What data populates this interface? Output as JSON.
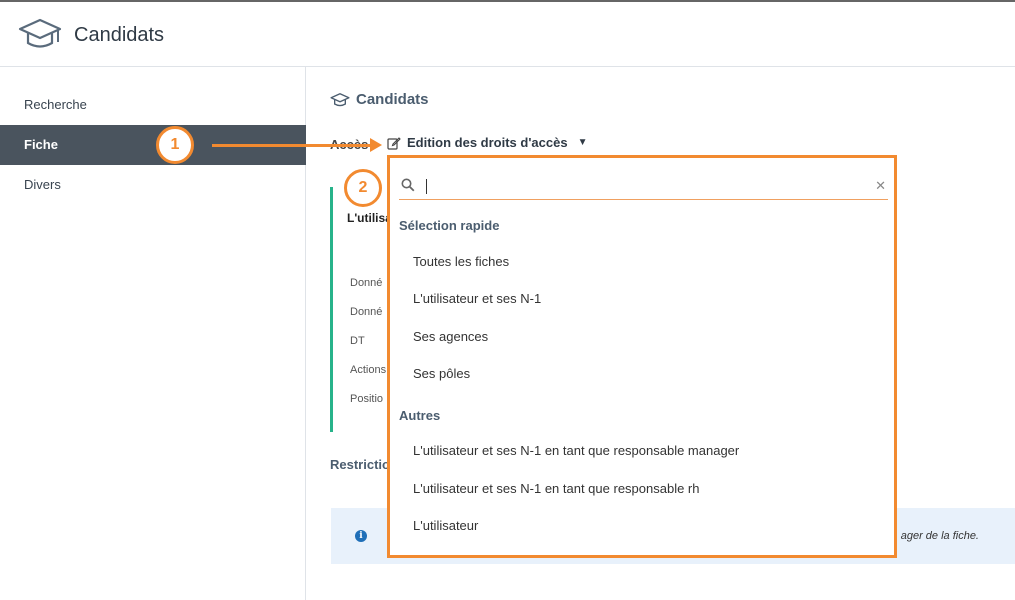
{
  "header": {
    "title": "Candidats",
    "logo_icon": "graduation-cap-icon"
  },
  "sidebar": {
    "items": [
      {
        "label": "Recherche",
        "active": false
      },
      {
        "label": "Fiche",
        "active": true
      },
      {
        "label": "Divers",
        "active": false
      }
    ]
  },
  "main": {
    "section_title": "Candidats",
    "access_label": "Accès",
    "edit_label": "Edition des droits d'accès",
    "card": {
      "title": "L'utilisa",
      "rows": [
        "Donné",
        "Donné",
        "DT",
        "Actions",
        "Positio"
      ]
    },
    "restrictions_label": "Restrictio",
    "info_text": "ager de la fiche."
  },
  "dropdown": {
    "search_value": "",
    "groups": [
      {
        "label": "Sélection rapide",
        "options": [
          "Toutes les fiches",
          "L'utilisateur et ses N-1",
          "Ses agences",
          "Ses pôles"
        ]
      },
      {
        "label": "Autres",
        "options": [
          "L'utilisateur et ses N-1 en tant que responsable manager",
          "L'utilisateur et ses N-1 en tant que responsable rh",
          "L'utilisateur"
        ]
      }
    ]
  },
  "annotations": {
    "step1": "1",
    "step2": "2"
  },
  "colors": {
    "accent": "#f28a30",
    "sidebar_active": "#4a545e",
    "card_border": "#27b38a",
    "info_bg": "#e8f1fb"
  }
}
